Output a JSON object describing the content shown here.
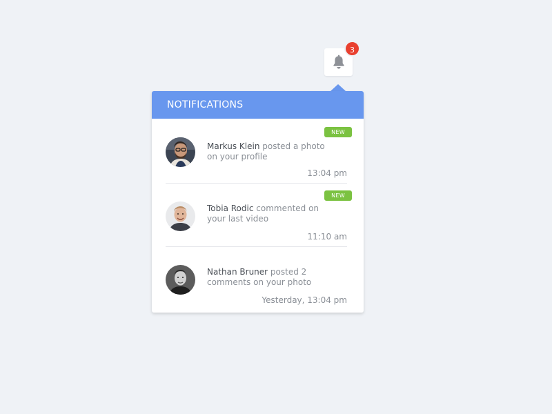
{
  "bell": {
    "icon": "bell-icon",
    "count": "3",
    "badge_color": "#e9402f"
  },
  "panel": {
    "title": "NOTIFICATIONS",
    "header_color": "#6897ee",
    "new_badge_color": "#7bc241"
  },
  "notifications": [
    {
      "name": "Markus Klein",
      "action": " posted a photo on your profile",
      "time": "13:04 pm",
      "badge": "NEW",
      "avatar": "avatar-markus-klein"
    },
    {
      "name": "Tobia Rodic",
      "action": " commented on your last video",
      "time": "11:10 am",
      "badge": "NEW",
      "avatar": "avatar-tobia-rodic"
    },
    {
      "name": "Nathan Bruner",
      "action": " posted 2 comments on your photo",
      "time": "Yesterday, 13:04 pm",
      "avatar": "avatar-nathan-bruner"
    }
  ]
}
